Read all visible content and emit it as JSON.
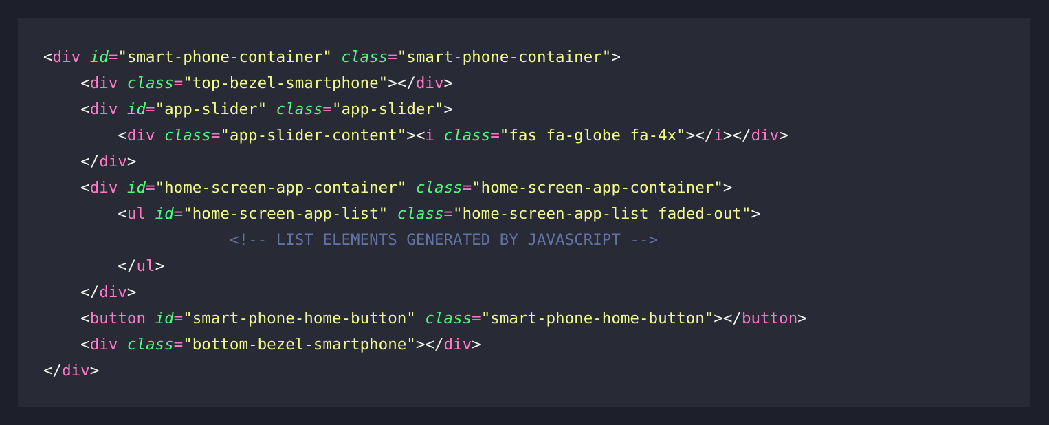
{
  "colors": {
    "page_background": "#1d202a",
    "panel_background": "#282a36",
    "punctuation": "#f8f8f2",
    "tag_name": "#ff79c6",
    "attribute_name": "#50fa7b",
    "operator": "#ff79c6",
    "string": "#f1fa8c",
    "comment": "#6272a4"
  },
  "code": {
    "language": "html",
    "lines": [
      [
        {
          "t": "punct",
          "v": "<"
        },
        {
          "t": "tag",
          "v": "div"
        },
        {
          "t": "punct",
          "v": " "
        },
        {
          "t": "attr",
          "v": "id"
        },
        {
          "t": "op",
          "v": "="
        },
        {
          "t": "str",
          "v": "\"smart-phone-container\""
        },
        {
          "t": "punct",
          "v": " "
        },
        {
          "t": "attr",
          "v": "class"
        },
        {
          "t": "op",
          "v": "="
        },
        {
          "t": "str",
          "v": "\"smart-phone-container\""
        },
        {
          "t": "punct",
          "v": ">"
        }
      ],
      [
        {
          "t": "punct",
          "v": "    <"
        },
        {
          "t": "tag",
          "v": "div"
        },
        {
          "t": "punct",
          "v": " "
        },
        {
          "t": "attr",
          "v": "class"
        },
        {
          "t": "op",
          "v": "="
        },
        {
          "t": "str",
          "v": "\"top-bezel-smartphone\""
        },
        {
          "t": "punct",
          "v": "></"
        },
        {
          "t": "tag",
          "v": "div"
        },
        {
          "t": "punct",
          "v": ">"
        }
      ],
      [
        {
          "t": "punct",
          "v": "    <"
        },
        {
          "t": "tag",
          "v": "div"
        },
        {
          "t": "punct",
          "v": " "
        },
        {
          "t": "attr",
          "v": "id"
        },
        {
          "t": "op",
          "v": "="
        },
        {
          "t": "str",
          "v": "\"app-slider\""
        },
        {
          "t": "punct",
          "v": " "
        },
        {
          "t": "attr",
          "v": "class"
        },
        {
          "t": "op",
          "v": "="
        },
        {
          "t": "str",
          "v": "\"app-slider\""
        },
        {
          "t": "punct",
          "v": ">"
        }
      ],
      [
        {
          "t": "punct",
          "v": "        <"
        },
        {
          "t": "tag",
          "v": "div"
        },
        {
          "t": "punct",
          "v": " "
        },
        {
          "t": "attr",
          "v": "class"
        },
        {
          "t": "op",
          "v": "="
        },
        {
          "t": "str",
          "v": "\"app-slider-content\""
        },
        {
          "t": "punct",
          "v": "><"
        },
        {
          "t": "tag",
          "v": "i"
        },
        {
          "t": "punct",
          "v": " "
        },
        {
          "t": "attr",
          "v": "class"
        },
        {
          "t": "op",
          "v": "="
        },
        {
          "t": "str",
          "v": "\"fas fa-globe fa-4x\""
        },
        {
          "t": "punct",
          "v": "></"
        },
        {
          "t": "tag",
          "v": "i"
        },
        {
          "t": "punct",
          "v": "></"
        },
        {
          "t": "tag",
          "v": "div"
        },
        {
          "t": "punct",
          "v": ">"
        }
      ],
      [
        {
          "t": "punct",
          "v": "    </"
        },
        {
          "t": "tag",
          "v": "div"
        },
        {
          "t": "punct",
          "v": ">"
        }
      ],
      [
        {
          "t": "punct",
          "v": "    <"
        },
        {
          "t": "tag",
          "v": "div"
        },
        {
          "t": "punct",
          "v": " "
        },
        {
          "t": "attr",
          "v": "id"
        },
        {
          "t": "op",
          "v": "="
        },
        {
          "t": "str",
          "v": "\"home-screen-app-container\""
        },
        {
          "t": "punct",
          "v": " "
        },
        {
          "t": "attr",
          "v": "class"
        },
        {
          "t": "op",
          "v": "="
        },
        {
          "t": "str",
          "v": "\"home-screen-app-container\""
        },
        {
          "t": "punct",
          "v": ">"
        }
      ],
      [
        {
          "t": "punct",
          "v": "        <"
        },
        {
          "t": "tag",
          "v": "ul"
        },
        {
          "t": "punct",
          "v": " "
        },
        {
          "t": "attr",
          "v": "id"
        },
        {
          "t": "op",
          "v": "="
        },
        {
          "t": "str",
          "v": "\"home-screen-app-list\""
        },
        {
          "t": "punct",
          "v": " "
        },
        {
          "t": "attr",
          "v": "class"
        },
        {
          "t": "op",
          "v": "="
        },
        {
          "t": "str",
          "v": "\"home-screen-app-list faded-out\""
        },
        {
          "t": "punct",
          "v": ">"
        }
      ],
      [
        {
          "t": "punct",
          "v": "                    "
        },
        {
          "t": "comment",
          "v": "<!-- LIST ELEMENTS GENERATED BY JAVASCRIPT -->"
        }
      ],
      [
        {
          "t": "punct",
          "v": "        </"
        },
        {
          "t": "tag",
          "v": "ul"
        },
        {
          "t": "punct",
          "v": ">"
        }
      ],
      [
        {
          "t": "punct",
          "v": "    </"
        },
        {
          "t": "tag",
          "v": "div"
        },
        {
          "t": "punct",
          "v": ">"
        }
      ],
      [
        {
          "t": "punct",
          "v": "    <"
        },
        {
          "t": "tag",
          "v": "button"
        },
        {
          "t": "punct",
          "v": " "
        },
        {
          "t": "attr",
          "v": "id"
        },
        {
          "t": "op",
          "v": "="
        },
        {
          "t": "str",
          "v": "\"smart-phone-home-button\""
        },
        {
          "t": "punct",
          "v": " "
        },
        {
          "t": "attr",
          "v": "class"
        },
        {
          "t": "op",
          "v": "="
        },
        {
          "t": "str",
          "v": "\"smart-phone-home-button\""
        },
        {
          "t": "punct",
          "v": "></"
        },
        {
          "t": "tag",
          "v": "button"
        },
        {
          "t": "punct",
          "v": ">"
        }
      ],
      [
        {
          "t": "punct",
          "v": "    <"
        },
        {
          "t": "tag",
          "v": "div"
        },
        {
          "t": "punct",
          "v": " "
        },
        {
          "t": "attr",
          "v": "class"
        },
        {
          "t": "op",
          "v": "="
        },
        {
          "t": "str",
          "v": "\"bottom-bezel-smartphone\""
        },
        {
          "t": "punct",
          "v": "></"
        },
        {
          "t": "tag",
          "v": "div"
        },
        {
          "t": "punct",
          "v": ">"
        }
      ],
      [
        {
          "t": "punct",
          "v": "</"
        },
        {
          "t": "tag",
          "v": "div"
        },
        {
          "t": "punct",
          "v": ">"
        }
      ]
    ]
  }
}
